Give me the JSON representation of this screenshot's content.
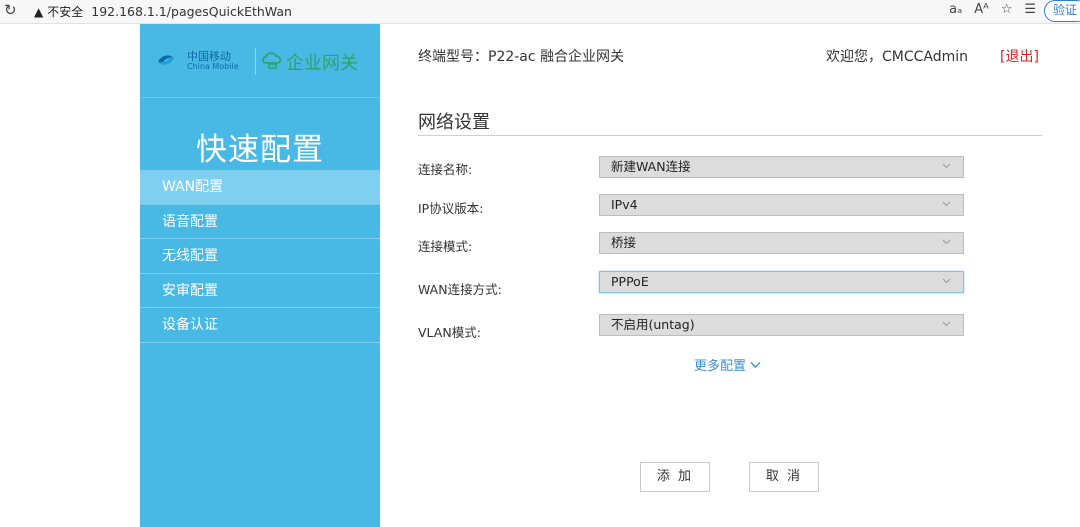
{
  "browser": {
    "security_label": "不安全",
    "url": "192.168.1.1/pagesQuickEthWan",
    "verify_label": "验证"
  },
  "brand": {
    "logo_cn": "中国移动",
    "logo_en": "China Mobile",
    "product": "企业网关",
    "colors": {
      "sidebar": "#48b8e4",
      "active_item": "#7ecff0",
      "logout": "#e02020",
      "link": "#3b8fd6"
    }
  },
  "sidebar": {
    "title": "快速配置",
    "items": [
      {
        "label": "WAN配置",
        "active": true
      },
      {
        "label": "语音配置",
        "active": false
      },
      {
        "label": "无线配置",
        "active": false
      },
      {
        "label": "安审配置",
        "active": false
      },
      {
        "label": "设备认证",
        "active": false
      }
    ]
  },
  "header": {
    "model": "终端型号：P22-ac 融合企业网关",
    "welcome": "欢迎您，CMCCAdmin",
    "logout": "[退出]"
  },
  "section": {
    "title": "网络设置"
  },
  "form": {
    "fields": [
      {
        "label": "连接名称:",
        "value": "新建WAN连接"
      },
      {
        "label": "IP协议版本:",
        "value": "IPv4"
      },
      {
        "label": "连接模式:",
        "value": "桥接"
      },
      {
        "label": "WAN连接方式:",
        "value": "PPPoE"
      },
      {
        "label": "VLAN模式:",
        "value": "不启用(untag)"
      }
    ],
    "more_label": "更多配置",
    "add_label": "添 加",
    "cancel_label": "取 消"
  }
}
